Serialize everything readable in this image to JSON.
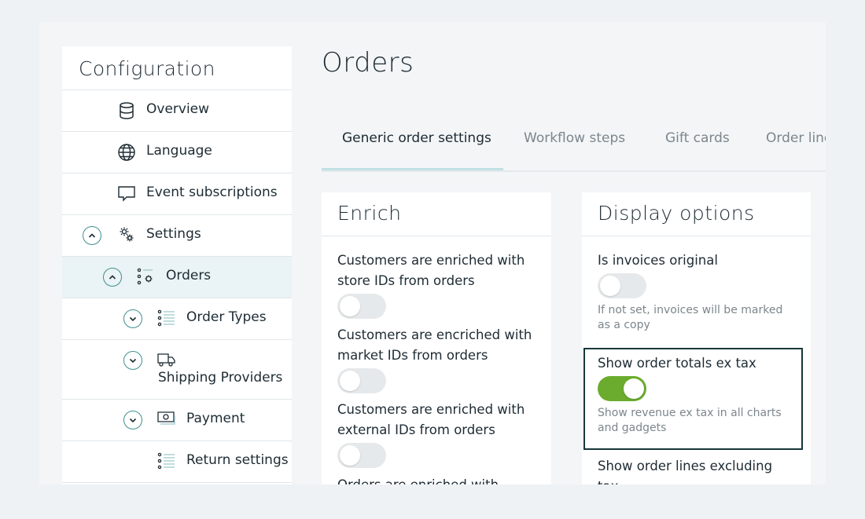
{
  "sidebar": {
    "title": "Configuration",
    "items": [
      {
        "label": "Overview",
        "icon": "database-icon"
      },
      {
        "label": "Language",
        "icon": "globe-icon"
      },
      {
        "label": "Event subscriptions",
        "icon": "speech-bubble-icon"
      },
      {
        "label": "Settings",
        "icon": "gears-icon",
        "expanded": true
      },
      {
        "label": "Orders",
        "icon": "list-gear-icon",
        "expanded": true,
        "active": true
      },
      {
        "label": "Order Types",
        "icon": "list-icon",
        "expanded": false
      },
      {
        "label": "Shipping Providers",
        "icon": "truck-icon",
        "expanded": false
      },
      {
        "label": "Payment",
        "icon": "money-icon",
        "expanded": false
      },
      {
        "label": "Return settings",
        "icon": "list-icon"
      }
    ]
  },
  "main": {
    "title": "Orders",
    "tabs": [
      "Generic order settings",
      "Workflow steps",
      "Gift cards",
      "Order lines"
    ],
    "active_tab": 0
  },
  "enrich": {
    "title": "Enrich",
    "options": [
      {
        "label": "Customers are enriched with store IDs from orders",
        "on": false
      },
      {
        "label": "Customers are encriched with market IDs from orders",
        "on": false
      },
      {
        "label": "Customers are enriched with external IDs from orders",
        "on": false
      },
      {
        "label": "Orders are enriched with",
        "on": false
      }
    ]
  },
  "display": {
    "title": "Display options",
    "options": [
      {
        "label": "Is invoices original",
        "on": false,
        "help": "If not set, invoices will be marked as a copy"
      },
      {
        "label": "Show order totals ex tax",
        "on": true,
        "help": "Show revenue ex tax in all charts and gadgets"
      },
      {
        "label": "Show order lines excluding tax",
        "on": false,
        "help": ""
      }
    ]
  },
  "colors": {
    "accent": "#3f8f8f",
    "toggle_on": "#6bac2e",
    "toggle_off": "#e6e9eb",
    "highlight_border": "#17373a"
  }
}
